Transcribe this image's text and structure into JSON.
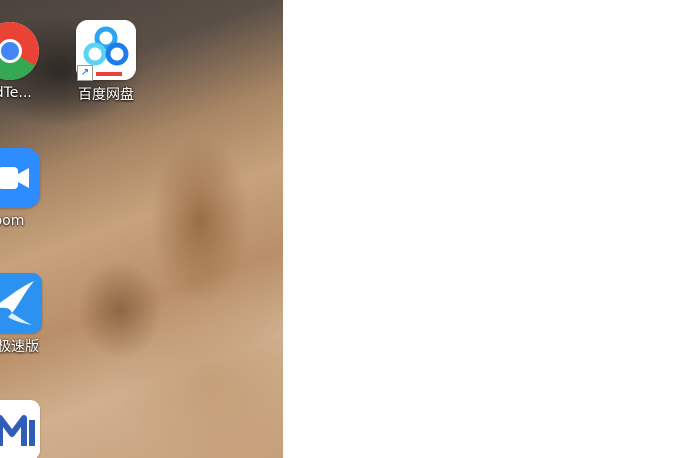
{
  "desktop": {
    "icons": [
      {
        "label": "ledTe...",
        "icon": "chrome-icon"
      },
      {
        "label": "百度网盘",
        "icon": "baidu-netdisk-icon"
      },
      {
        "label": "oom",
        "icon": "zoom-icon"
      },
      {
        "label": "极速版",
        "icon": "bird-app-icon"
      },
      {
        "label": "",
        "icon": "m-app-icon"
      }
    ]
  }
}
